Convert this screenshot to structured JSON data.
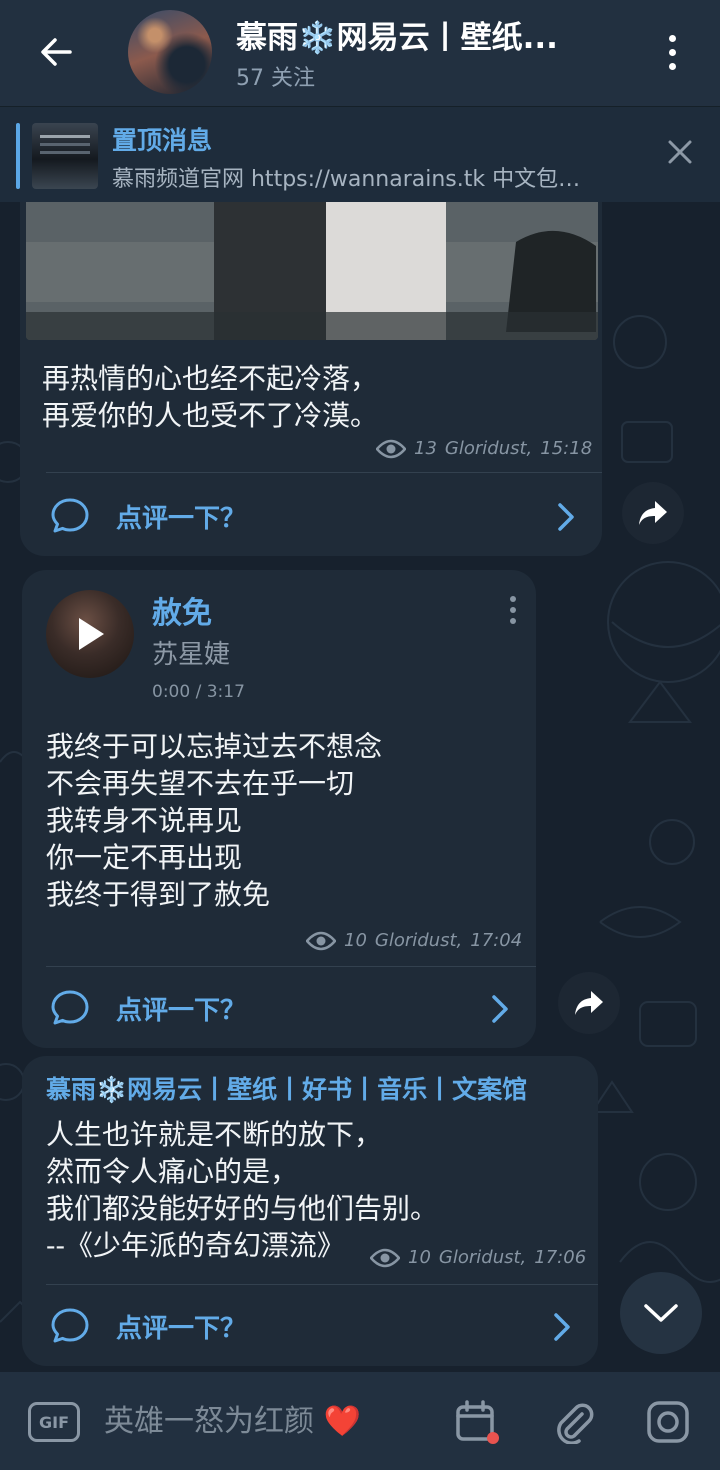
{
  "header": {
    "title": "慕雨❄️网易云丨壁纸...",
    "subtitle": "57 关注"
  },
  "pinned": {
    "title": "置顶消息",
    "text": "慕雨频道官网 https://wannarains.tk 中文包…"
  },
  "messages": [
    {
      "text": "再热情的心也经不起冷落，\n再爱你的人也受不了冷漠。",
      "views": "13",
      "author": "Gloridust",
      "time": "15:18",
      "comment_label": "点评一下？"
    },
    {
      "song_title": "赦免",
      "song_artist": "苏星婕",
      "song_time": "0:00 / 3:17",
      "text": "我终于可以忘掉过去不想念\n不会再失望不去在乎一切\n我转身不说再见\n你一定不再出现\n我终于得到了赦免",
      "views": "10",
      "author": "Gloridust",
      "time": "17:04",
      "comment_label": "点评一下？"
    },
    {
      "sender": "慕雨❄️网易云丨壁纸丨好书丨音乐丨文案馆",
      "text": "人生也许就是不断的放下，\n然而令人痛心的是，\n我们都没能好好的与他们告别。\n--《少年派的奇幻漂流》",
      "views": "10",
      "author": "Gloridust",
      "time": "17:06",
      "comment_label": "点评一下？"
    }
  ],
  "input": {
    "placeholder": "英雄一怒为红颜 ❤️",
    "gif_label": "GIF"
  },
  "colors": {
    "accent": "#62abe8",
    "background": "#17212d",
    "bubble": "#1f2b38",
    "header": "#223040"
  },
  "icons": [
    "back-arrow-icon",
    "more-vert-icon",
    "close-icon",
    "eye-icon",
    "comment-icon",
    "chevron-right-icon",
    "share-icon",
    "play-icon",
    "chevron-down-icon",
    "calendar-icon",
    "attach-icon",
    "camera-icon"
  ]
}
